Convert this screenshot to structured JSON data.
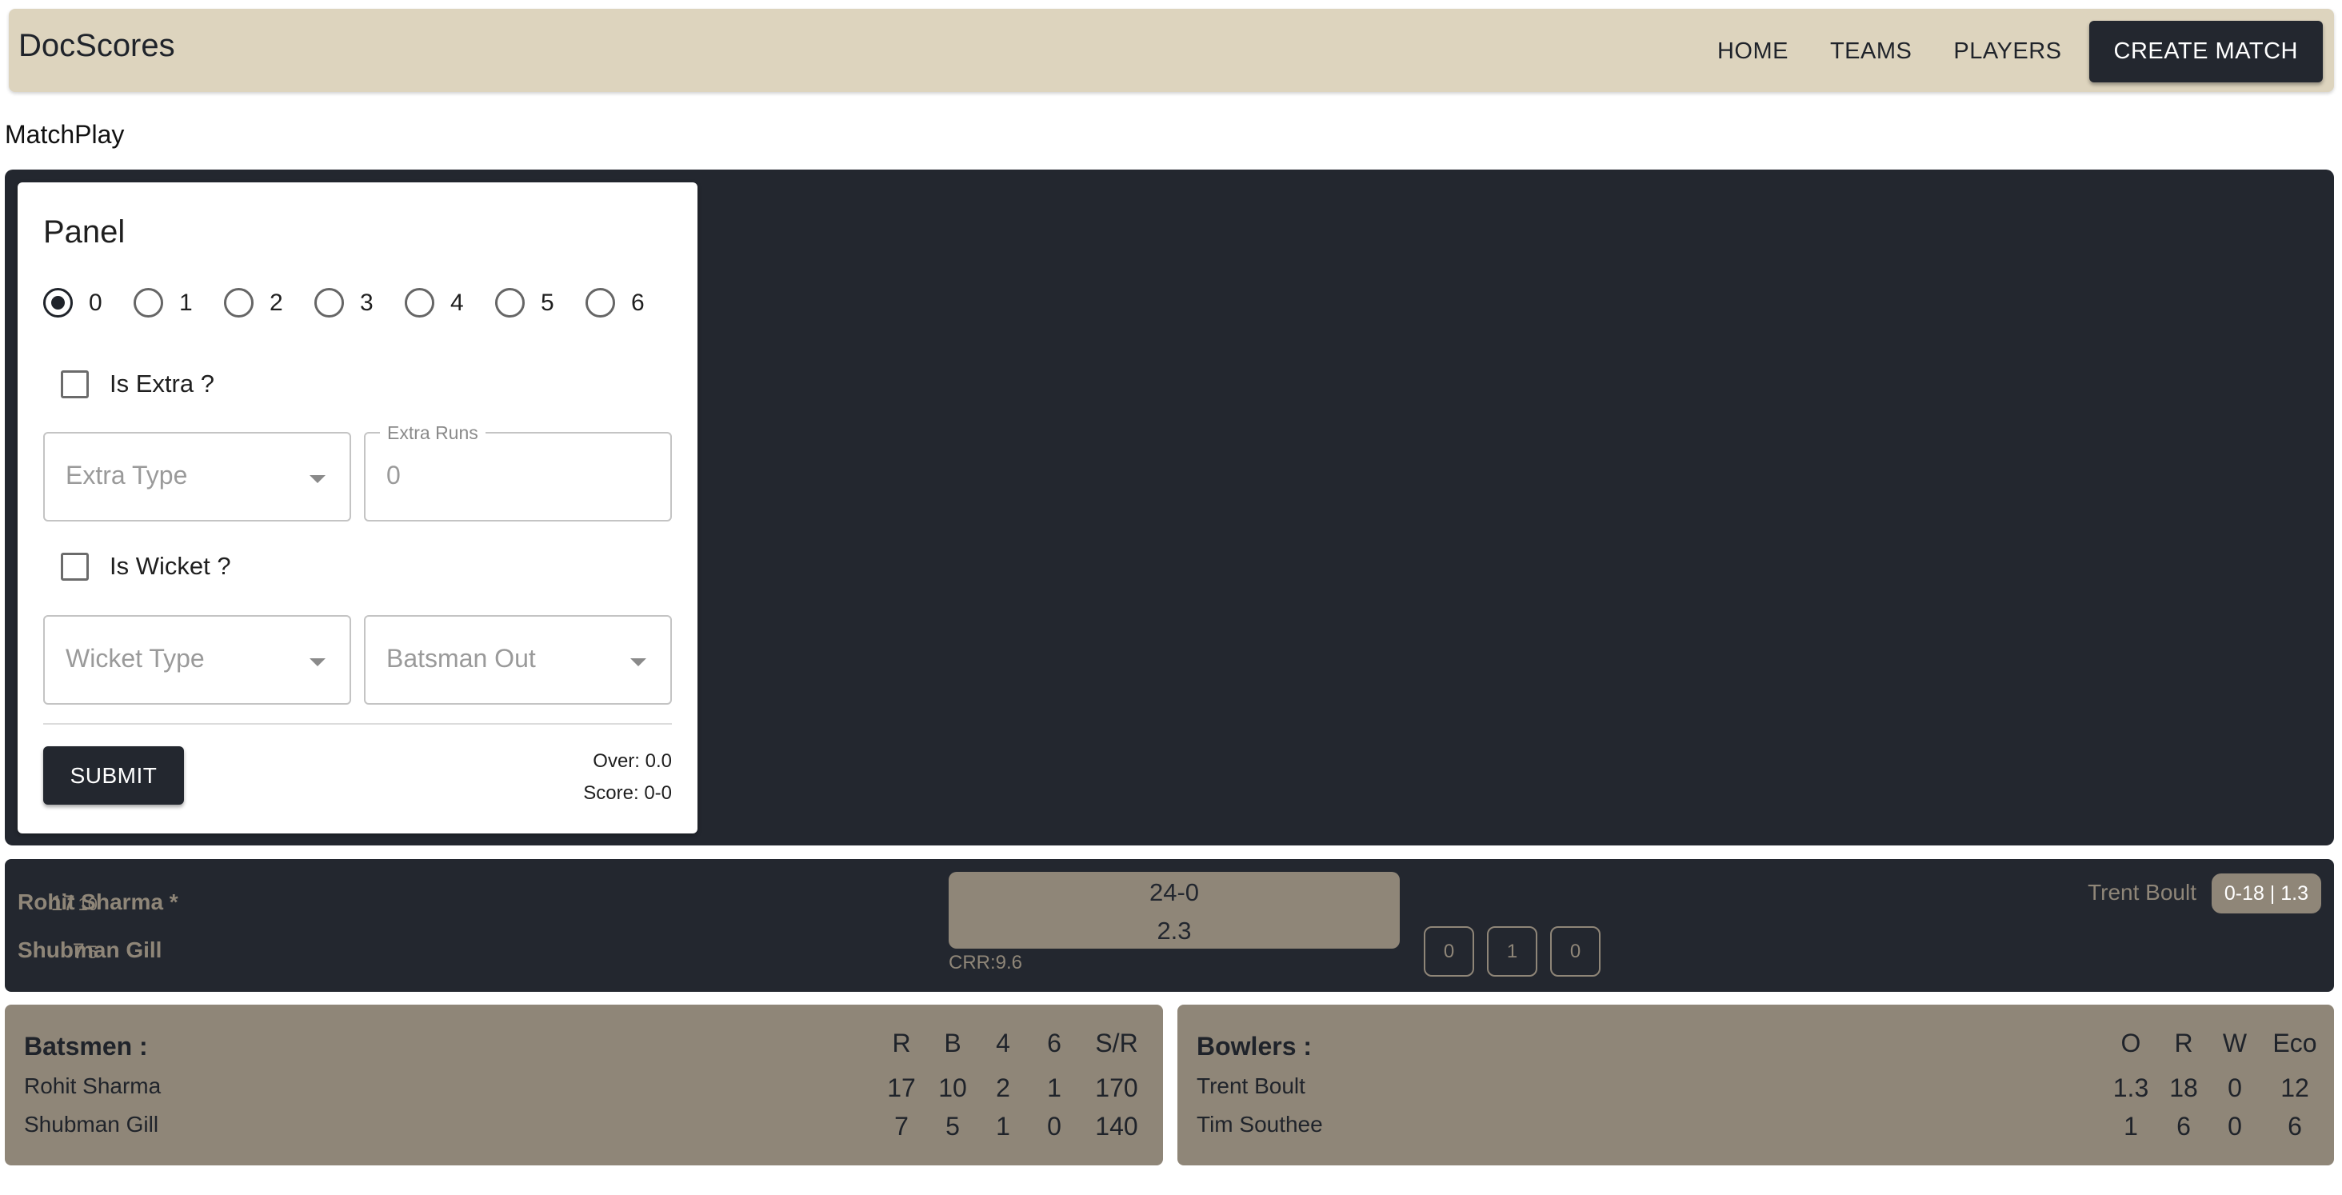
{
  "app": {
    "brand": "DocScores",
    "nav": {
      "home": "HOME",
      "teams": "TEAMS",
      "players": "PLAYERS",
      "create_match": "CREATE MATCH"
    }
  },
  "page": {
    "title": "MatchPlay"
  },
  "panel": {
    "title": "Panel",
    "run_options": [
      "0",
      "1",
      "2",
      "3",
      "4",
      "5",
      "6"
    ],
    "selected_run": "0",
    "is_extra_label": "Is Extra ?",
    "extra_type_placeholder": "Extra Type",
    "extra_runs_label": "Extra Runs",
    "extra_runs_value": "0",
    "is_wicket_label": "Is Wicket ?",
    "wicket_type_placeholder": "Wicket Type",
    "batsman_out_placeholder": "Batsman Out",
    "submit_label": "SUBMIT",
    "over_text": "Over: 0.0",
    "score_text": "Score: 0-0"
  },
  "scorebar": {
    "batters": [
      {
        "name": "Rohit Sharma *",
        "runs": "17",
        "balls": "10"
      },
      {
        "name": "Shubman Gill",
        "runs": "7",
        "balls": "5"
      }
    ],
    "team_score": "24-0",
    "overs": "2.3",
    "crr": "CRR:9.6",
    "recent_balls": [
      "0",
      "1",
      "0"
    ],
    "bowler_name": "Trent Boult",
    "bowler_figures": "0-18 | 1.3"
  },
  "batsmen_card": {
    "title": "Batsmen :",
    "headers": [
      "R",
      "B",
      "4",
      "6",
      "S/R"
    ],
    "rows": [
      {
        "name": "Rohit Sharma",
        "values": [
          "17",
          "10",
          "2",
          "1",
          "170"
        ]
      },
      {
        "name": "Shubman Gill",
        "values": [
          "7",
          "5",
          "1",
          "0",
          "140"
        ]
      }
    ]
  },
  "bowlers_card": {
    "title": "Bowlers :",
    "headers": [
      "O",
      "R",
      "W",
      "Eco"
    ],
    "rows": [
      {
        "name": "Trent Boult",
        "values": [
          "1.3",
          "18",
          "0",
          "12"
        ]
      },
      {
        "name": "Tim Southee",
        "values": [
          "1",
          "6",
          "0",
          "6"
        ]
      }
    ]
  },
  "colors": {
    "navbar_bg": "#ddd4be",
    "dark_bg": "#23272f",
    "tan": "#8f8678"
  }
}
